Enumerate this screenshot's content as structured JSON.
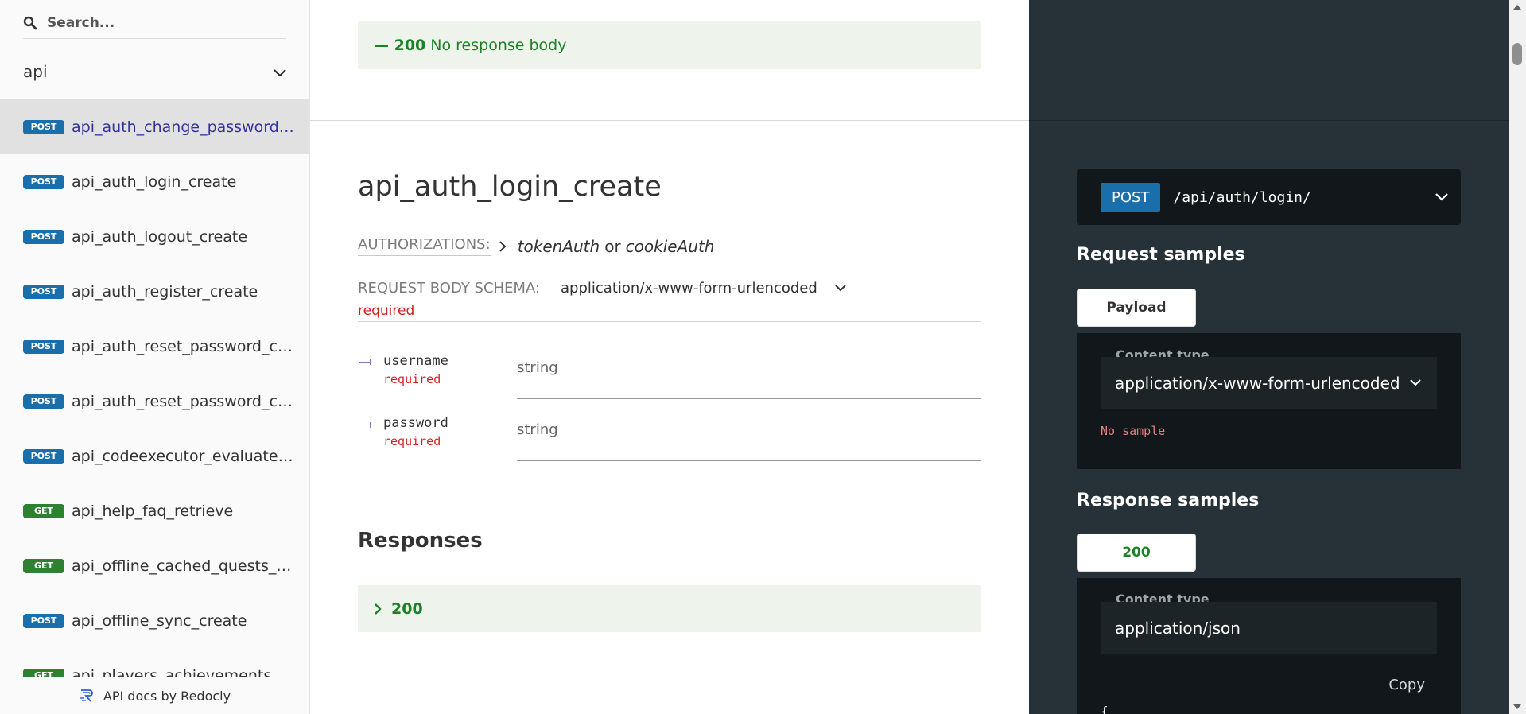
{
  "sidebar": {
    "search_placeholder": "Search...",
    "version": "api",
    "items": [
      {
        "method": "POST",
        "label": "api_auth_change_password_create",
        "active": true
      },
      {
        "method": "POST",
        "label": "api_auth_login_create",
        "active": false
      },
      {
        "method": "POST",
        "label": "api_auth_logout_create",
        "active": false
      },
      {
        "method": "POST",
        "label": "api_auth_register_create",
        "active": false
      },
      {
        "method": "POST",
        "label": "api_auth_reset_password_confirm_create",
        "active": false
      },
      {
        "method": "POST",
        "label": "api_auth_reset_password_create",
        "active": false
      },
      {
        "method": "POST",
        "label": "api_codeexecutor_evaluate_create",
        "active": false
      },
      {
        "method": "GET",
        "label": "api_help_faq_retrieve",
        "active": false
      },
      {
        "method": "GET",
        "label": "api_offline_cached_quests_retrieve",
        "active": false
      },
      {
        "method": "POST",
        "label": "api_offline_sync_create",
        "active": false
      },
      {
        "method": "GET",
        "label": "api_players_achievements_retrieve",
        "active": false
      }
    ],
    "footer": "API docs by Redocly"
  },
  "main": {
    "prev_response": {
      "code": "— 200",
      "text": "No response body"
    },
    "operation_title": "api_auth_login_create",
    "authorizations_label": "AUTHORIZATIONS:",
    "auth_1": "tokenAuth",
    "auth_or": "or",
    "auth_2": "cookieAuth",
    "schema_label": "REQUEST BODY SCHEMA:",
    "schema_value": "application/x-www-form-urlencoded",
    "body_required": "required",
    "properties": [
      {
        "name": "username",
        "required": "required",
        "type": "string"
      },
      {
        "name": "password",
        "required": "required",
        "type": "string"
      }
    ],
    "responses_title": "Responses",
    "response_code": "200"
  },
  "right_panel": {
    "method": "POST",
    "path": "/api/auth/login/",
    "request_samples_title": "Request samples",
    "payload_tab": "Payload",
    "content_type_label": "Content type",
    "request_content_type": "application/x-www-form-urlencoded",
    "no_sample": "No sample",
    "response_samples_title": "Response samples",
    "response_tab": "200",
    "response_content_type_label": "Content type",
    "response_content_type": "application/json",
    "copy": "Copy",
    "json_open": "{"
  },
  "colors": {
    "post": "#186fac",
    "get": "#2f8132",
    "success_green": "#1d8127",
    "required_red": "#d41f1c",
    "right_panel_bg": "#263238",
    "active_link": "#32329f"
  }
}
